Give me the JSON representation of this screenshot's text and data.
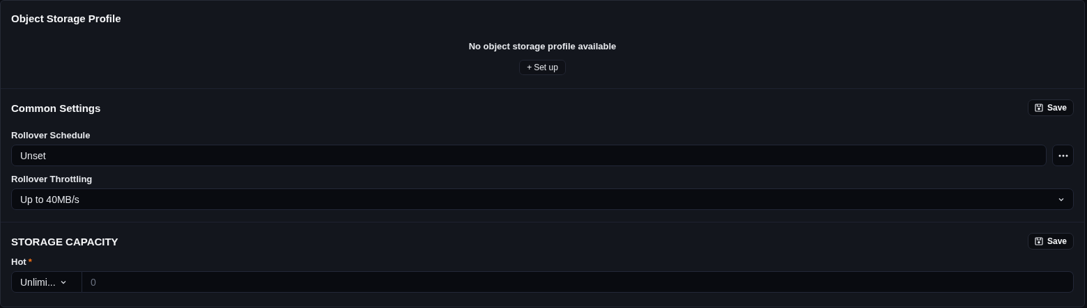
{
  "object_storage": {
    "title": "Object Storage Profile",
    "empty_message": "No object storage profile available",
    "setup_button": {
      "icon": "+",
      "label": "Set up"
    }
  },
  "common_settings": {
    "title": "Common Settings",
    "save_button": "Save",
    "fields": [
      {
        "kind": "text-menu",
        "label": "Rollover Schedule",
        "value": "Unset"
      },
      {
        "kind": "select",
        "label": "Rollover Throttling",
        "value": "Up to 40MB/s"
      }
    ]
  },
  "storage_capacity": {
    "title": "STORAGE CAPACITY",
    "save_button": "Save",
    "fields": [
      {
        "kind": "unit-number",
        "label": "Hot",
        "required_mark": "*",
        "unit": "Unlimi...",
        "placeholder": "0"
      }
    ]
  }
}
